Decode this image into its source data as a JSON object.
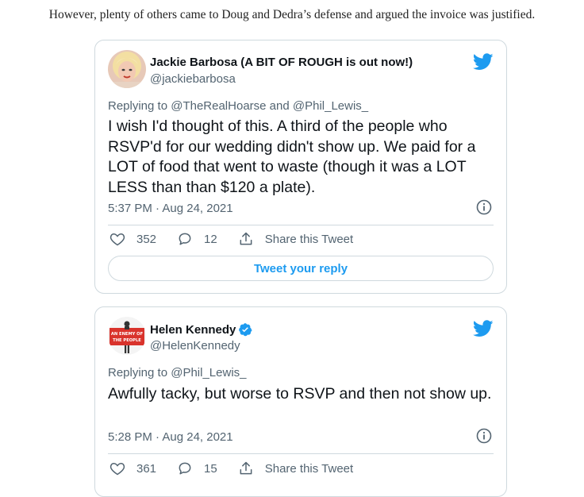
{
  "article": {
    "intro_text": "However, plenty of others came to Doug and Dedra’s defense and argued the invoice was justified."
  },
  "colors": {
    "twitter_blue": "#1d9bf0",
    "secondary_text": "#536471",
    "border": "#cfd9de"
  },
  "tweets": [
    {
      "display_name": "Jackie Barbosa (A BIT OF ROUGH is out now!)",
      "handle": "@jackiebarbosa",
      "verified": false,
      "replying_prefix": "Replying to",
      "reply_mention_1": "@TheRealHoarse",
      "reply_joiner": "and",
      "reply_mention_2": "@Phil_Lewis_",
      "text": "I wish I'd thought of this. A third of the people who RSVP'd for our wedding didn't show up. We paid for a LOT of food that went to waste (though it was a LOT LESS than than $120 a plate).",
      "timestamp": "5:37 PM · Aug 24, 2021",
      "likes": "352",
      "replies": "12",
      "share_label": "Share this Tweet",
      "reply_button_label": "Tweet your reply",
      "avatar_icon": "profile-photo"
    },
    {
      "display_name": "Helen Kennedy",
      "handle": "@HelenKennedy",
      "verified": true,
      "replying_prefix": "Replying to",
      "reply_mention_1": "@Phil_Lewis_",
      "text": "Awfully tacky, but worse to RSVP and then not show up.",
      "timestamp": "5:28 PM · Aug 24, 2021",
      "likes": "361",
      "replies": "15",
      "share_label": "Share this Tweet",
      "avatar_icon": "enemy-of-the-people-logo",
      "avatar_line_1": "AN ENEMY OF",
      "avatar_line_2": "THE PEOPLE"
    }
  ]
}
